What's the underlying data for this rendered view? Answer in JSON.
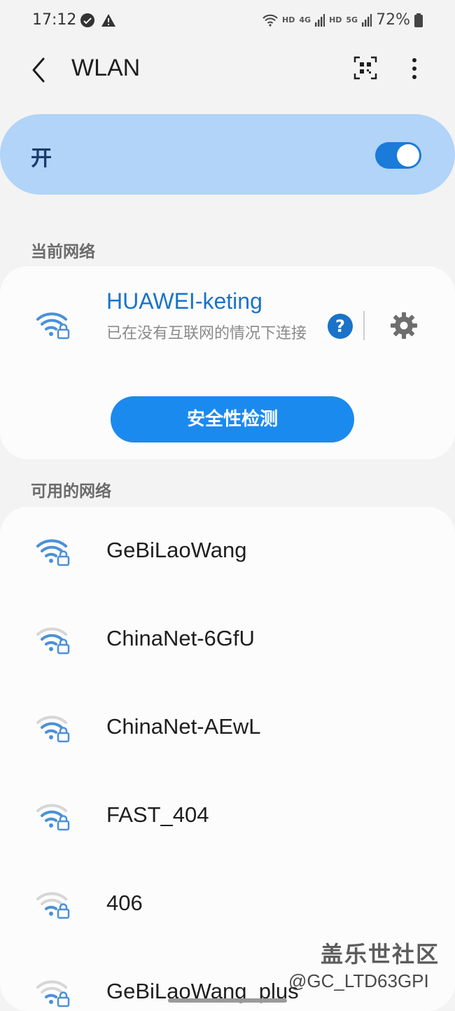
{
  "status_bar": {
    "time": "17:12",
    "hd1": "HD",
    "lte": "4G",
    "hd2": "HD",
    "fiveg": "5G",
    "battery": "72%"
  },
  "app_bar": {
    "title": "WLAN",
    "icons": [
      "back-icon",
      "qr-scan-icon",
      "more-vert-icon"
    ]
  },
  "master": {
    "label": "开",
    "enabled": true,
    "accent": "#1a7bd9"
  },
  "current_section": {
    "header": "当前网络",
    "network": {
      "name": "HUAWEI-keting",
      "status": "已在没有互联网的情况下连接",
      "help_label": "?",
      "action_label": "安全性检测"
    }
  },
  "available_section": {
    "header": "可用的网络",
    "networks": [
      {
        "name": "GeBiLaoWang",
        "strong": true
      },
      {
        "name": "ChinaNet-6GfU",
        "strong": false
      },
      {
        "name": "ChinaNet-AEwL",
        "strong": false
      },
      {
        "name": "FAST_404",
        "strong": false
      },
      {
        "name": "406",
        "strong": false
      },
      {
        "name": "GeBiLaoWang_plus",
        "strong": false
      }
    ]
  },
  "watermark": {
    "logo": "盖乐世社区",
    "user": "@GC_LTD63GPI"
  }
}
